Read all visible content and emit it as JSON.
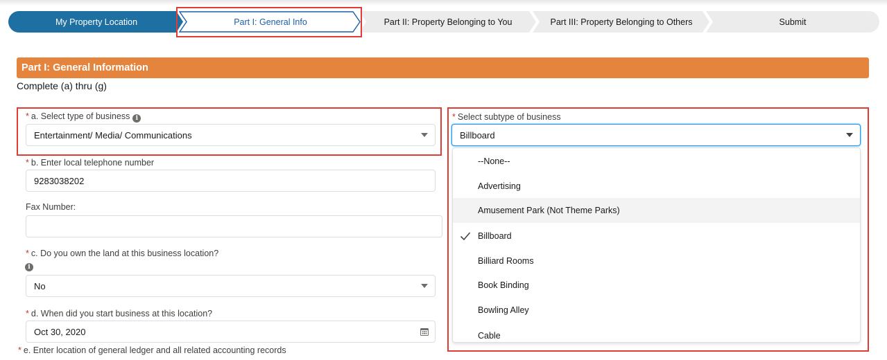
{
  "path": {
    "steps": [
      {
        "label": "My Property Location",
        "state": "done"
      },
      {
        "label": "Part I: General Info",
        "state": "current"
      },
      {
        "label": "Part II: Property Belonging to You",
        "state": "incomplete"
      },
      {
        "label": "Part III: Property Belonging to Others",
        "state": "incomplete"
      },
      {
        "label": "Submit",
        "state": "incomplete"
      }
    ]
  },
  "section": {
    "title": "Part I: General Information",
    "subtitle": "Complete (a) thru (g)"
  },
  "form": {
    "required_mark": "*",
    "business_type": {
      "label": "a. Select type of business",
      "value": "Entertainment/ Media/ Communications"
    },
    "telephone": {
      "label": "b. Enter local telephone number",
      "value": "9283038202"
    },
    "fax": {
      "label": "Fax Number:",
      "value": ""
    },
    "own_land": {
      "label": "c. Do you own the land at this business location?",
      "value": "No"
    },
    "start_date": {
      "label": "d. When did you start business at this location?",
      "value": "Oct 30, 2020"
    },
    "ledger": {
      "label": "e. Enter location of general ledger and all related accounting records"
    },
    "subtype": {
      "label": "Select subtype of business",
      "value": "Billboard",
      "options": [
        "--None--",
        "Advertising",
        "Amusement Park (Not Theme Parks)",
        "Billboard",
        "Billiard Rooms",
        "Book Binding",
        "Bowling Alley",
        "Cable"
      ],
      "selected_index": 3,
      "hover_index": 2
    }
  },
  "colors": {
    "path_done": "#1e6fa2",
    "path_current_border": "#1b5fa8",
    "path_incomplete": "#ececec",
    "section_header": "#e5843c",
    "highlight_box": "#e23b34",
    "required": "#c23934"
  },
  "icons": {
    "info": "info-icon",
    "dropdown": "chevron-down-icon",
    "calendar": "calendar-icon",
    "selected": "check-icon"
  }
}
